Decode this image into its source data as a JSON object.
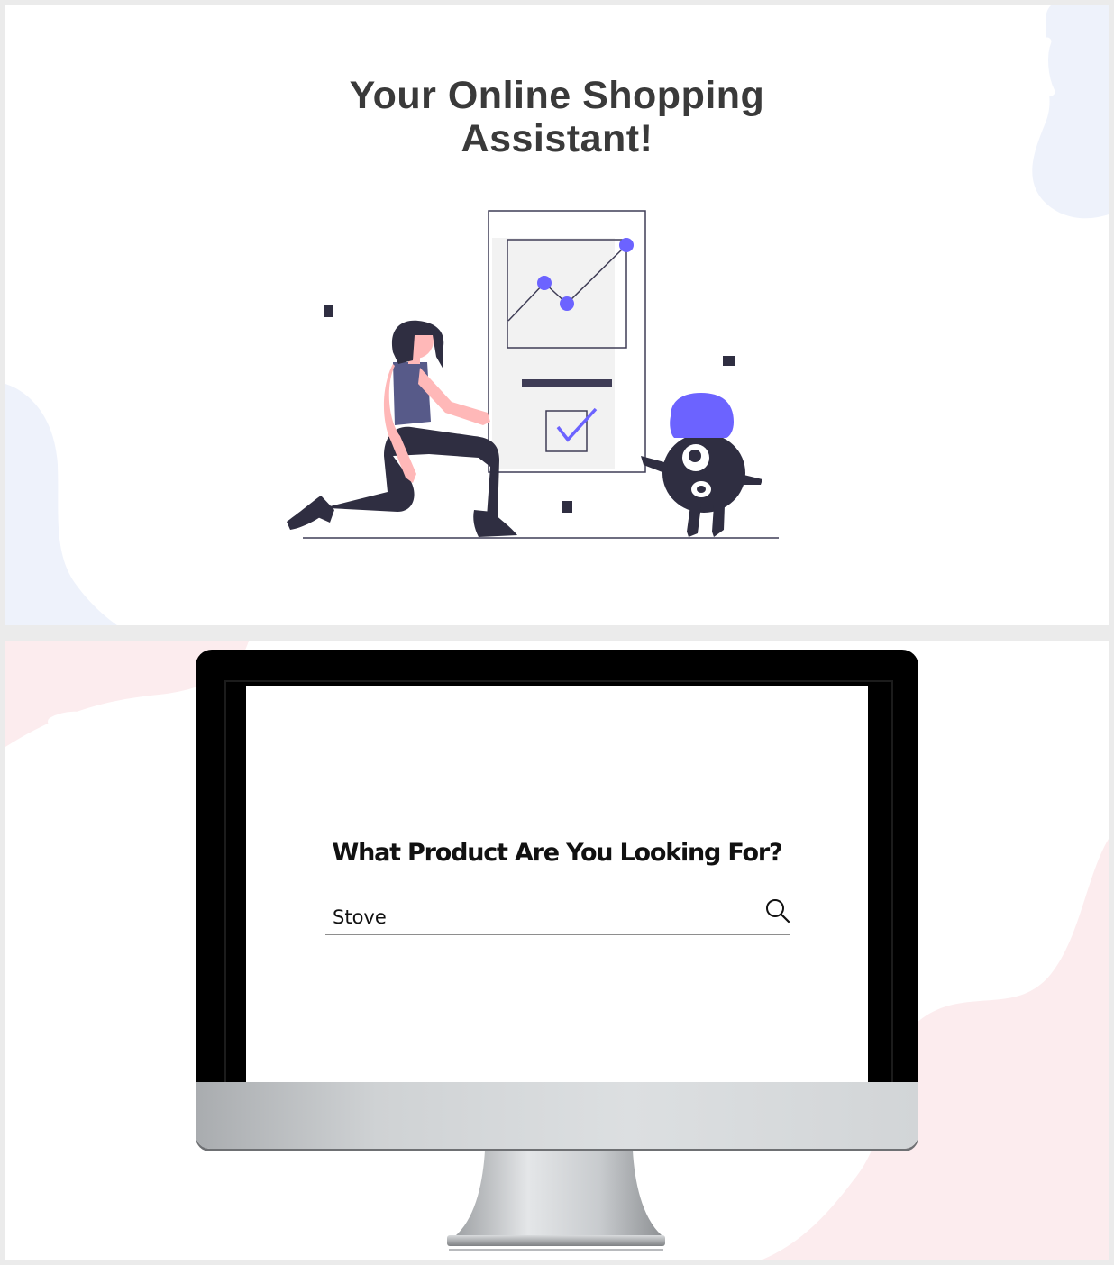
{
  "hero": {
    "title_line1": "Your Online Shopping",
    "title_line2": "Assistant!"
  },
  "search": {
    "heading": "What Product Are You Looking For?",
    "value": "Stove",
    "icon": "search-icon"
  },
  "colors": {
    "accent": "#6c63ff",
    "title": "#3a3a3a",
    "dark_figure": "#2f2e41",
    "skin": "#ffb8b8",
    "blob_blue": "#eef2fb",
    "blob_pink": "#fcecee"
  }
}
